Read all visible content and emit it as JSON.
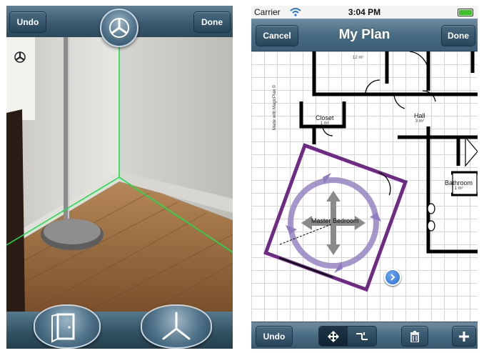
{
  "left_screen": {
    "undo_label": "Undo",
    "done_label": "Done",
    "icons": {
      "top_center": "tripod-compass-icon",
      "small_corner": "tripod-small-icon",
      "bottom_left": "door-icon",
      "bottom_right": "corner-axes-icon"
    },
    "guide_color": "#19e34a"
  },
  "right_screen": {
    "status": {
      "carrier": "Carrier",
      "time": "3:04 PM"
    },
    "nav": {
      "cancel_label": "Cancel",
      "title": "My Plan",
      "done_label": "Done"
    },
    "rooms": {
      "closet": {
        "name": "Closet",
        "area": "1 m²"
      },
      "hall": {
        "name": "Hall",
        "area": "3 m²"
      },
      "bathroom": {
        "name": "Bathroom",
        "area": "1 m²"
      },
      "master_bedroom": {
        "name": "Master Bedroom"
      },
      "top_area": "12 m²"
    },
    "watermark": "Made with MagicPlan ©",
    "toolbar": {
      "undo_label": "Undo",
      "icons": [
        "move-arrows-icon",
        "split-wall-icon",
        "trash-icon",
        "plus-icon"
      ]
    },
    "colors": {
      "selected_room": "#6f2a86",
      "rotate_ring": "#8f7dbf",
      "walls": "#000000",
      "info_button": "#2f6fd0"
    }
  }
}
